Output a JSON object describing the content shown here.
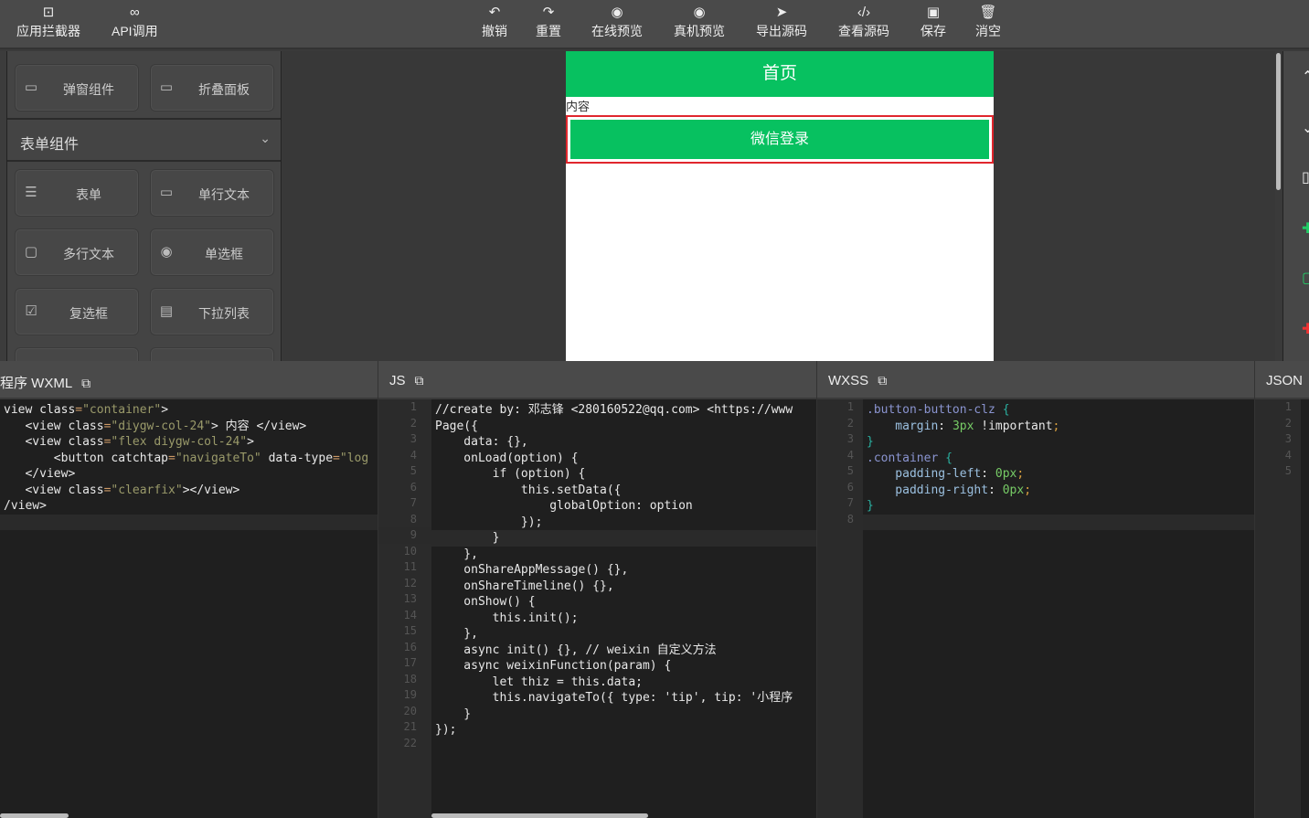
{
  "toolbar": {
    "left": [
      {
        "label": "应用拦截器",
        "icon": "code-box-icon"
      },
      {
        "label": "API调用",
        "icon": "link-icon"
      }
    ],
    "center": [
      {
        "label": "撤销",
        "icon": "undo-icon"
      },
      {
        "label": "重置",
        "icon": "redo-icon"
      },
      {
        "label": "在线预览",
        "icon": "eye-icon"
      },
      {
        "label": "真机预览",
        "icon": "eye-icon"
      },
      {
        "label": "导出源码",
        "icon": "send-icon"
      },
      {
        "label": "查看源码",
        "icon": "code-icon"
      },
      {
        "label": "保存",
        "icon": "save-icon"
      },
      {
        "label": "消空",
        "icon": "trash-icon"
      }
    ]
  },
  "sidebar": {
    "top_items": [
      "弹窗组件",
      "折叠面板"
    ],
    "section": "表单组件",
    "items": [
      "表单",
      "单行文本",
      "多行文本",
      "单选框",
      "复选框",
      "下拉列表"
    ]
  },
  "preview": {
    "title": "首页",
    "content": "内容",
    "button": "微信登录"
  },
  "panels": {
    "wxml": {
      "title": "程序 WXML",
      "lines": [
        [
          [
            "view class",
            "t"
          ],
          [
            "=",
            "p"
          ],
          [
            "\"container\"",
            "s"
          ],
          [
            ">",
            "t"
          ]
        ],
        [
          [
            "   <view class",
            "t"
          ],
          [
            "=",
            "p"
          ],
          [
            "\"diygw-col-24\"",
            "s"
          ],
          [
            "> 内容 </view>",
            "t"
          ]
        ],
        [
          [
            "   <view class",
            "t"
          ],
          [
            "=",
            "p"
          ],
          [
            "\"flex diygw-col-24\"",
            "s"
          ],
          [
            ">",
            "t"
          ]
        ],
        [
          [
            "       <button catchtap",
            "t"
          ],
          [
            "=",
            "p"
          ],
          [
            "\"navigateTo\"",
            "s"
          ],
          [
            " data-type",
            "t"
          ],
          [
            "=",
            "p"
          ],
          [
            "\"log",
            "s"
          ]
        ],
        [
          [
            "   </view>",
            "t"
          ]
        ],
        [
          [
            "   <view class",
            "t"
          ],
          [
            "=",
            "p"
          ],
          [
            "\"clearfix\"",
            "s"
          ],
          [
            "></view>",
            "t"
          ]
        ],
        [
          [
            "/view>",
            "t"
          ]
        ]
      ]
    },
    "js": {
      "title": "JS",
      "lines": [
        "//create by: 邓志锋 <280160522@qq.com> <https://www",
        "Page({",
        "    data: {},",
        "    onLoad(option) {",
        "        if (option) {",
        "            this.setData({",
        "                globalOption: option",
        "            });",
        "        }",
        "    },",
        "    onShareAppMessage() {},",
        "    onShareTimeline() {},",
        "    onShow() {",
        "        this.init();",
        "    },",
        "    async init() {}, // weixin 自定义方法",
        "    async weixinFunction(param) {",
        "        let thiz = this.data;",
        "        this.navigateTo({ type: 'tip', tip: '小程序",
        "    }",
        "});",
        ""
      ]
    },
    "wxss": {
      "title": "WXSS",
      "lines": [
        [
          [
            ".button-button-clz ",
            "sel"
          ],
          [
            "{",
            "br"
          ]
        ],
        [
          [
            "    margin",
            "kw"
          ],
          [
            ": ",
            "t"
          ],
          [
            "3px",
            "num"
          ],
          [
            " !important",
            "t"
          ],
          [
            ";",
            "pn"
          ]
        ],
        [
          [
            "}",
            "br"
          ]
        ],
        [
          [
            ".container ",
            "sel"
          ],
          [
            "{",
            "br"
          ]
        ],
        [
          [
            "    padding-left",
            "kw"
          ],
          [
            ": ",
            "t"
          ],
          [
            "0px",
            "num"
          ],
          [
            ";",
            "pn"
          ]
        ],
        [
          [
            "    padding-right",
            "kw"
          ],
          [
            ": ",
            "t"
          ],
          [
            "0px",
            "num"
          ],
          [
            ";",
            "pn"
          ]
        ],
        [
          [
            "}",
            "br"
          ]
        ],
        [
          [
            "",
            "t"
          ]
        ]
      ]
    },
    "json": {
      "title": "JSON",
      "line_count": 5
    }
  },
  "colors": {
    "brand": "#07c160",
    "selection": "#e0262d"
  }
}
